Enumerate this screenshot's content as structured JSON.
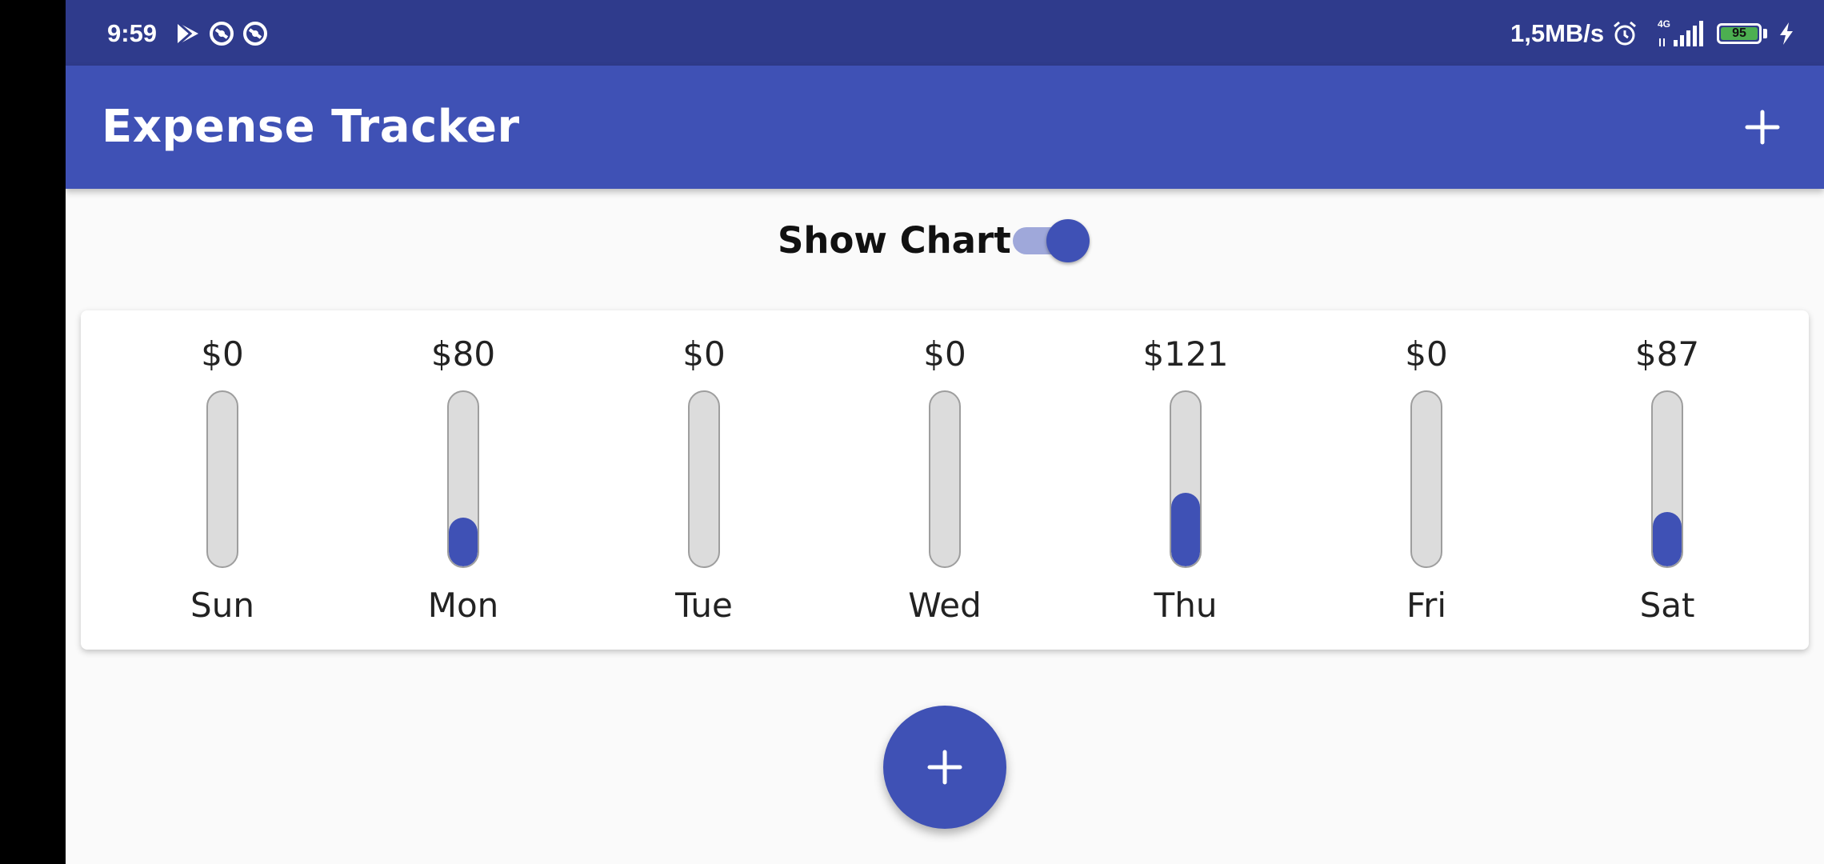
{
  "status_bar": {
    "time": "9:59",
    "network_speed": "1,5MB/s",
    "network_type": "4G",
    "battery_level": "95",
    "icons": [
      "play-store-icon",
      "sync-icon",
      "sync-icon",
      "alarm-icon",
      "signal-icon",
      "battery-icon",
      "charging-icon"
    ]
  },
  "app_bar": {
    "title": "Expense Tracker",
    "action_icon": "add-icon"
  },
  "toggle": {
    "label": "Show Chart",
    "checked": true
  },
  "chart_data": {
    "type": "bar",
    "categories": [
      "Sun",
      "Mon",
      "Tue",
      "Wed",
      "Thu",
      "Fri",
      "Sat"
    ],
    "values": [
      0,
      80,
      0,
      0,
      121,
      0,
      87
    ],
    "value_labels": [
      "$0",
      "$80",
      "$0",
      "$0",
      "$121",
      "$0",
      "$87"
    ],
    "fill_fraction": [
      0,
      0.28,
      0,
      0,
      0.42,
      0,
      0.31
    ]
  },
  "fab": {
    "icon": "add-icon"
  },
  "colors": {
    "primary": "#3f51b5",
    "status_bar": "#2f3b8c",
    "track": "#dcdcdc",
    "switch_track": "#9fa8da",
    "battery": "#4caf50"
  }
}
